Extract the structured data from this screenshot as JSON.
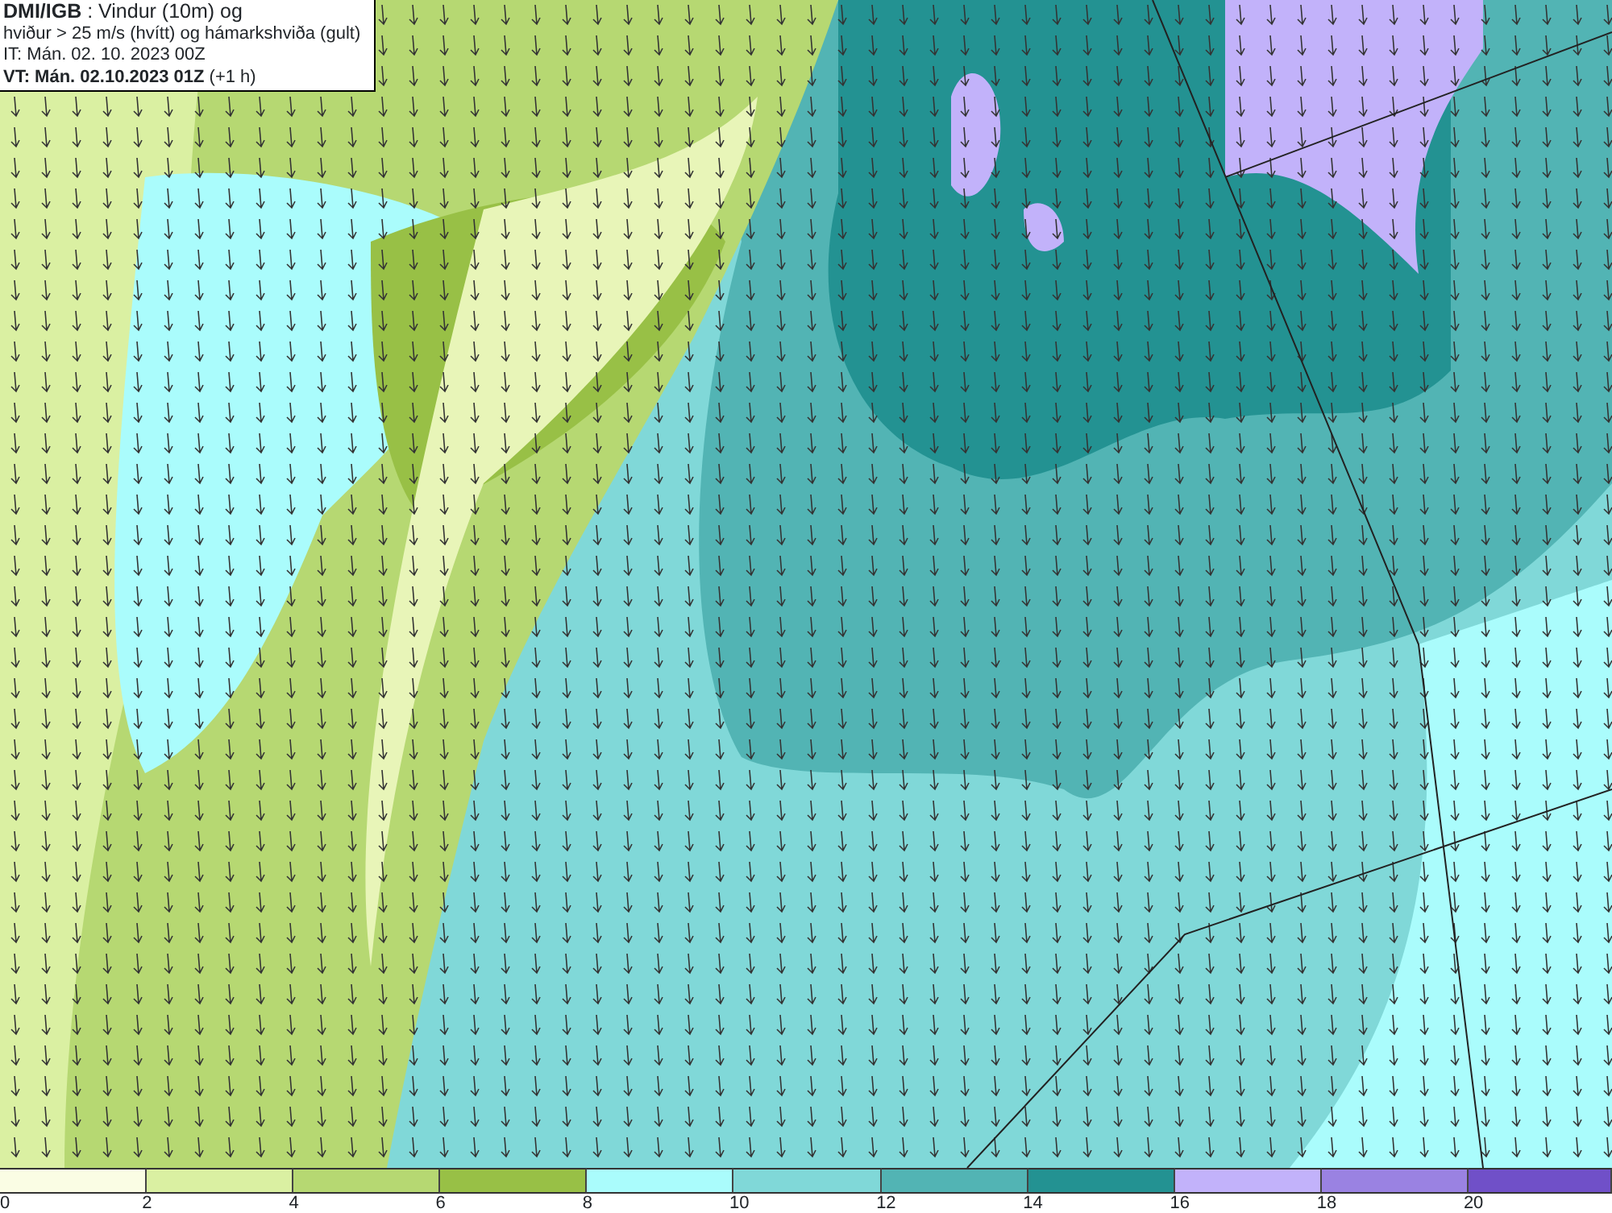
{
  "map": {
    "title_lines": [
      "**DMI/IGB** : Vindur (10m) og",
      "hviður > 25 m/s (hvítt) og hámarkshviða (gult)",
      "IT: Mán. 02. 10. 2023 00Z",
      "**VT: Mán. 02.10.2023 01Z** (+1 h)"
    ]
  },
  "legend": [
    {
      "label": "0",
      "color": "#fafde4"
    },
    {
      "label": "2",
      "color": "#daf0a2"
    },
    {
      "label": "4",
      "color": "#b6d872"
    },
    {
      "label": "6",
      "color": "#98c046"
    },
    {
      "label": "8",
      "color": "#aafcfc"
    },
    {
      "label": "10",
      "color": "#80d8d8"
    },
    {
      "label": "12",
      "color": "#52b4b4"
    },
    {
      "label": "14",
      "color": "#239292"
    },
    {
      "label": "16",
      "color": "#c2b2fa"
    },
    {
      "label": "18",
      "color": "#9a82e2"
    },
    {
      "label": "20",
      "color": "#7050c8"
    }
  ]
}
